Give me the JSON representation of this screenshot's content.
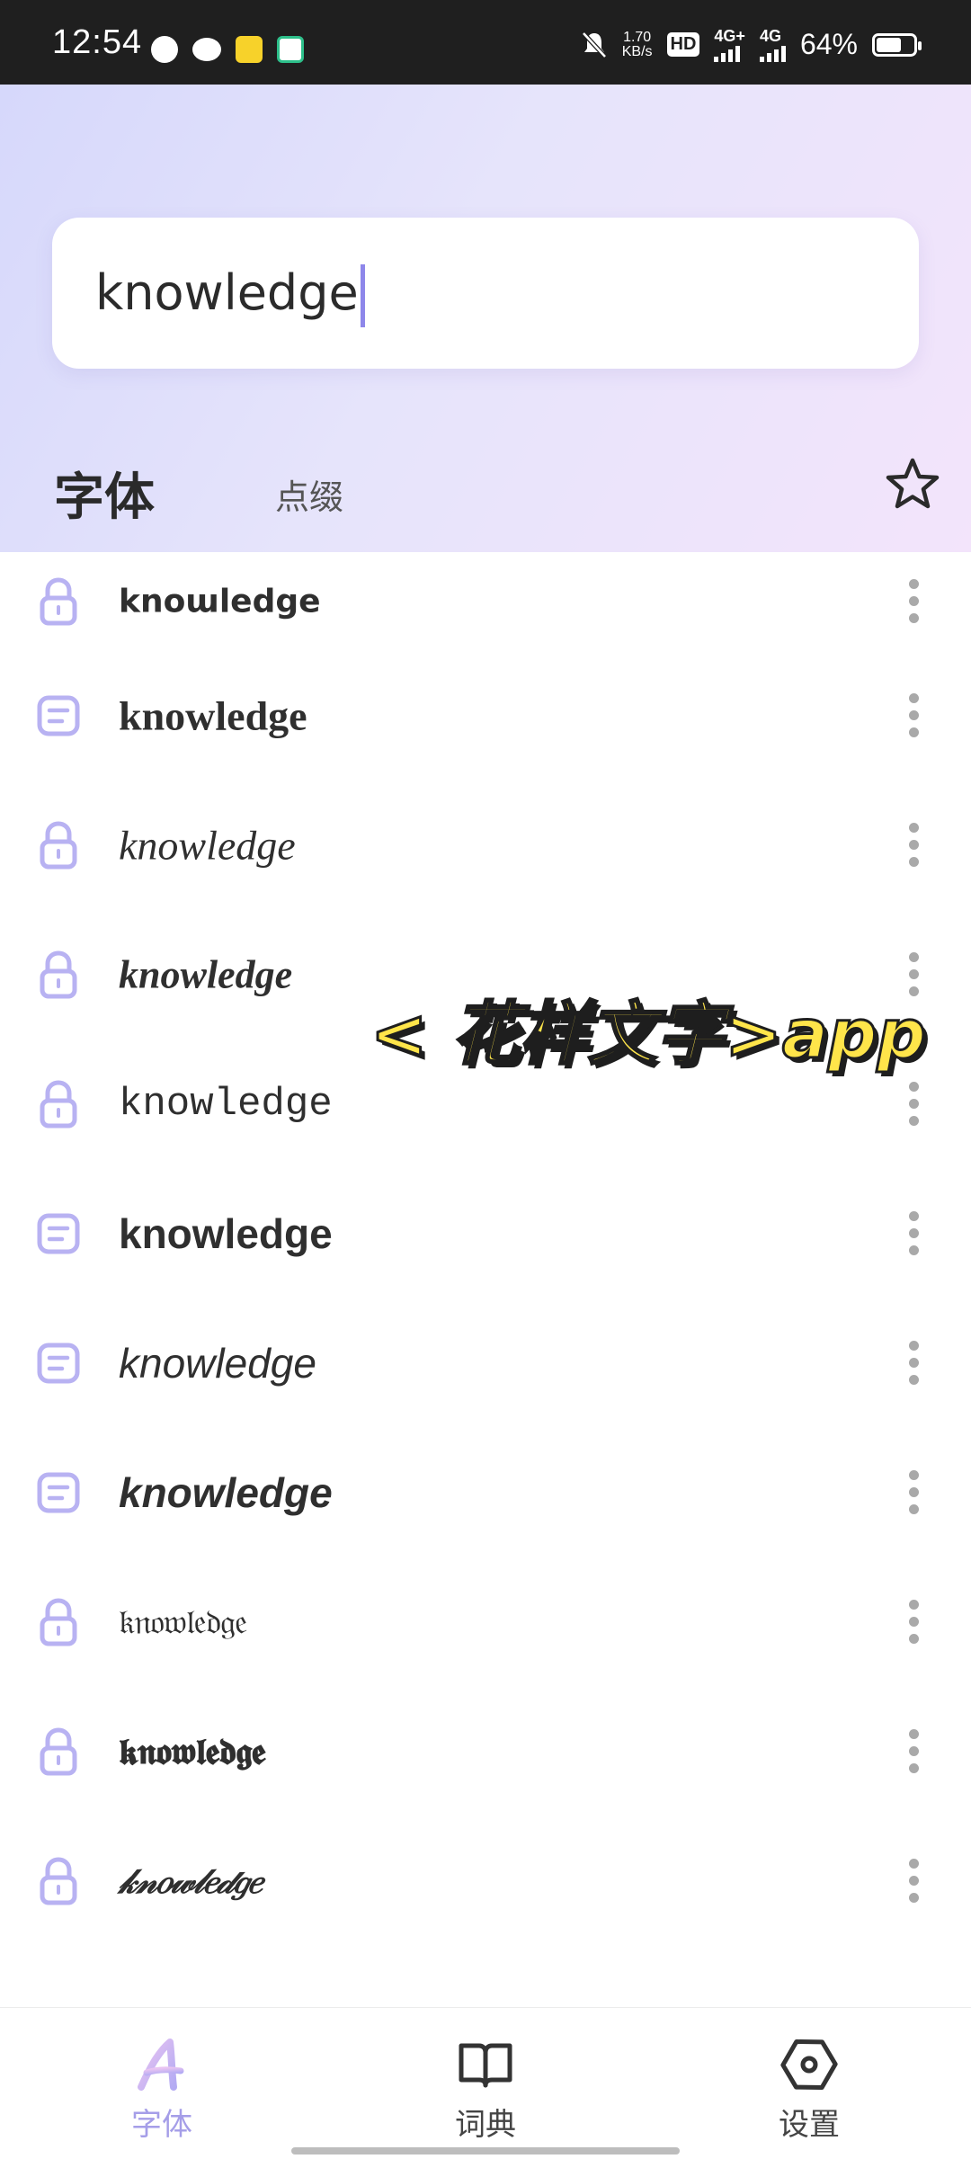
{
  "status_bar": {
    "time": "12:54",
    "speed_value": "1.70",
    "speed_unit": "KB/s",
    "hd": "HD",
    "net1": "4G+",
    "net2": "4G",
    "battery_percent": "64%"
  },
  "search": {
    "value": "knowledge"
  },
  "tabs": {
    "fonts": "字体",
    "decorations": "点缀"
  },
  "font_list": [
    {
      "text": "knoɯledge",
      "locked": true
    },
    {
      "text": "knowledge",
      "locked": false
    },
    {
      "text": "knowledge",
      "locked": true
    },
    {
      "text": "knowledge",
      "locked": true
    },
    {
      "text": "knowledge",
      "locked": true
    },
    {
      "text": "knowledge",
      "locked": false
    },
    {
      "text": "knowledge",
      "locked": false
    },
    {
      "text": "knowledge",
      "locked": false
    },
    {
      "text": "𝔨𝔫𝔬𝔴𝔩𝔢𝔡𝔤𝔢",
      "locked": true
    },
    {
      "text": "𝖐𝖓𝖔𝖜𝖑𝖊𝖉𝖌𝖊",
      "locked": true
    },
    {
      "text": "𝓀𝓃𝑜𝓌𝓁𝑒𝒹𝑔𝑒",
      "locked": true
    }
  ],
  "overlay_caption": "< 花样文字>app",
  "bottom_nav": {
    "fonts": "字体",
    "dictionary": "词典",
    "settings": "设置"
  },
  "colors": {
    "accent": "#a59ee8",
    "icon_tint": "#b8b2f2",
    "caption_fill": "#ffe54a"
  }
}
